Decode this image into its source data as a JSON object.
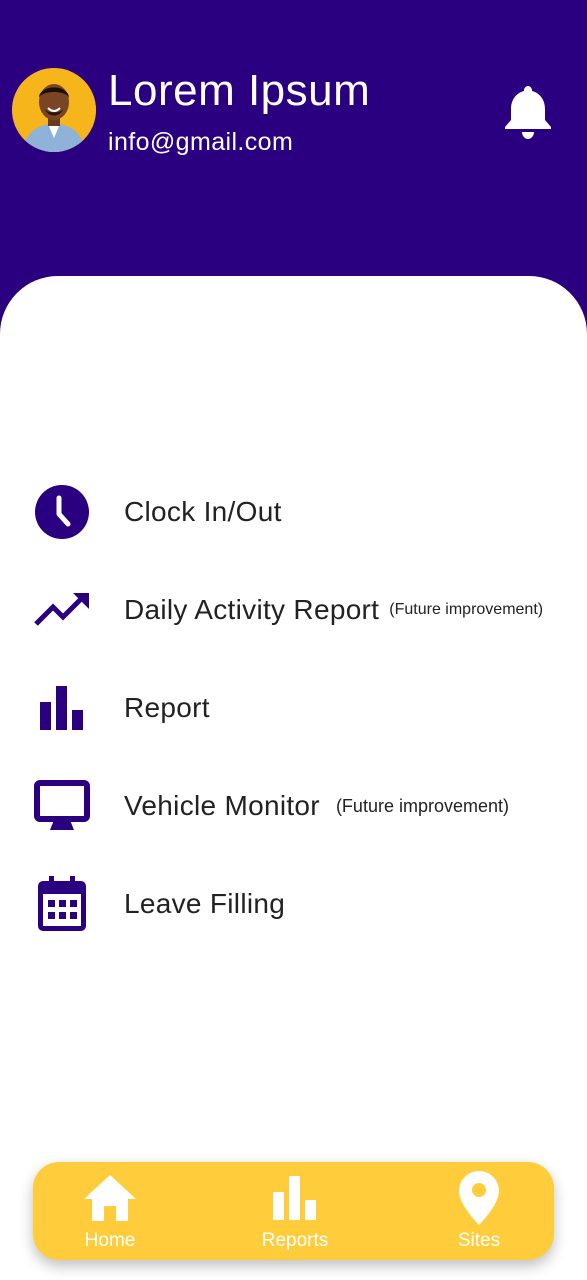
{
  "profile": {
    "name": "Lorem Ipsum",
    "email": "info@gmail.com"
  },
  "menu": {
    "items": [
      {
        "label": "Clock In/Out",
        "note": "",
        "icon": "clock-icon"
      },
      {
        "label": "Daily Activity Report",
        "note": "(Future improvement)",
        "icon": "trending-up-icon"
      },
      {
        "label": "Report",
        "note": "",
        "icon": "bar-chart-icon"
      },
      {
        "label": "Vehicle Monitor",
        "note": "(Future improvement)",
        "icon": "monitor-icon"
      },
      {
        "label": "Leave Filling",
        "note": "",
        "icon": "calendar-icon"
      }
    ]
  },
  "bottom_nav": {
    "items": [
      {
        "label": "Home",
        "icon": "home-icon"
      },
      {
        "label": "Reports",
        "icon": "bar-chart-icon"
      },
      {
        "label": "Sites",
        "icon": "location-pin-icon"
      }
    ]
  },
  "colors": {
    "primary": "#2a0080",
    "accent": "#ffcd3c",
    "avatar_bg": "#f7b51c"
  }
}
